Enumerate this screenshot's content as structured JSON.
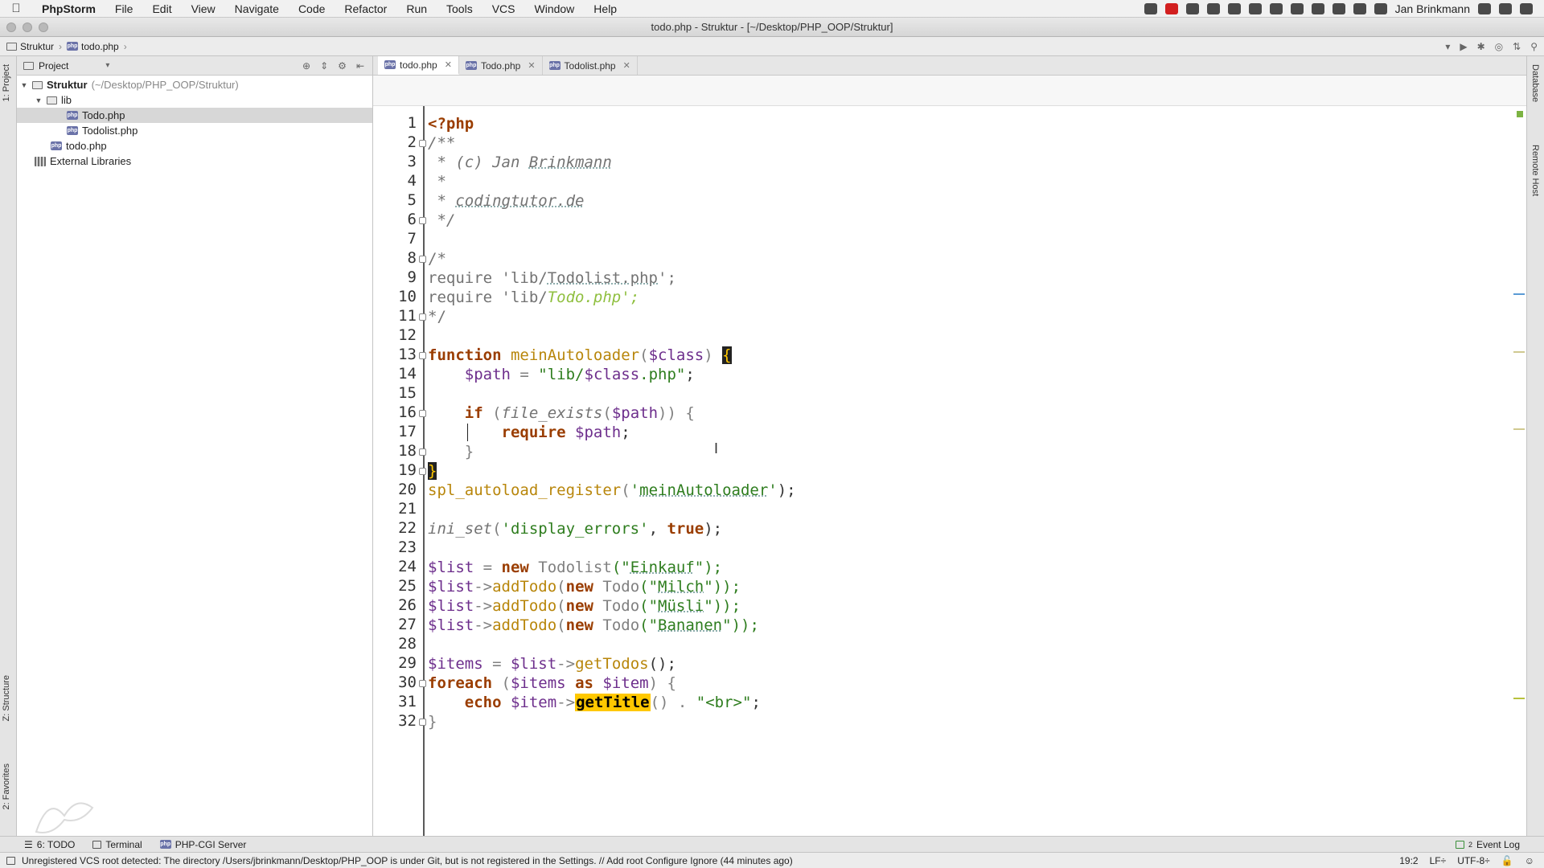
{
  "menubar": {
    "app": "PhpStorm",
    "items": [
      "File",
      "Edit",
      "View",
      "Navigate",
      "Code",
      "Refactor",
      "Run",
      "Tools",
      "VCS",
      "Window",
      "Help"
    ],
    "user": "Jan Brinkmann"
  },
  "window": {
    "title": "todo.php - Struktur - [~/Desktop/PHP_OOP/Struktur]"
  },
  "navbar": {
    "crumbs": [
      "Struktur",
      "todo.php"
    ]
  },
  "left_strip": {
    "project_tab": "1: Project",
    "structure_tab": "Z: Structure",
    "favorites_tab": "2: Favorites"
  },
  "project_panel": {
    "title": "Project",
    "tree": [
      {
        "label": "Struktur",
        "path": "(~/Desktop/PHP_OOP/Struktur)",
        "icon": "folder-icon",
        "expanded": true
      },
      {
        "label": "lib",
        "icon": "folder-icon",
        "expanded": true
      },
      {
        "label": "Todo.php",
        "icon": "php-file-icon",
        "selected": true
      },
      {
        "label": "Todolist.php",
        "icon": "php-file-icon"
      },
      {
        "label": "todo.php",
        "icon": "php-file-icon"
      },
      {
        "label": "External Libraries",
        "icon": "library-icon"
      }
    ]
  },
  "editor": {
    "tabs": [
      {
        "label": "todo.php",
        "active": true
      },
      {
        "label": "Todo.php",
        "active": false
      },
      {
        "label": "Todolist.php",
        "active": false
      }
    ],
    "line_numbers": [
      "1",
      "2",
      "3",
      "4",
      "5",
      "6",
      "7",
      "8",
      "9",
      "10",
      "11",
      "12",
      "13",
      "14",
      "15",
      "16",
      "17",
      "18",
      "19",
      "20",
      "21",
      "22",
      "23",
      "24",
      "25",
      "26",
      "27",
      "28",
      "29",
      "30",
      "31",
      "32"
    ],
    "code": {
      "l1": "<?php",
      "l2": "/**",
      "l3a": " * (c) Jan ",
      "l3b": "Brinkmann",
      "l4": " *",
      "l5a": " * ",
      "l5b": "codingtutor.de",
      "l6": " */",
      "l8": "/*",
      "l9a": "require 'lib/",
      "l9b": "Todolist.php",
      "l9c": "';",
      "l10a": "require 'lib/",
      "l10b": "Todo.php';",
      "l11": "*/",
      "l13a": "function ",
      "l13b": "meinAutoloader",
      "l13c": "(",
      "l13d": "$class",
      "l13e": ") ",
      "l13f": "{",
      "l14a": "    ",
      "l14b": "$path",
      "l14c": " = ",
      "l14d": "\"lib/",
      "l14e": "$class",
      "l14f": ".php\"",
      "l14g": ";",
      "l16a": "    ",
      "l16b": "if",
      "l16c": " (",
      "l16d": "file_exists",
      "l16e": "(",
      "l16f": "$path",
      "l16g": ")) {",
      "l17a": "        ",
      "l17b": "require",
      "l17c": " ",
      "l17d": "$path",
      "l17e": ";",
      "l18": "    }",
      "l19": "}",
      "l20a": "spl_autoload_register",
      "l20b": "(",
      "l20c": "'",
      "l20d": "meinAutoloader",
      "l20e": "'",
      "l20f": ");",
      "l22a": "ini_set",
      "l22b": "(",
      "l22c": "'display_errors'",
      "l22d": ", ",
      "l22e": "true",
      "l22f": ");",
      "l24a": "$list",
      "l24b": " = ",
      "l24c": "new",
      "l24d": " Todolist",
      "l24e": "(\"",
      "l24f": "Einkauf",
      "l24g": "\");",
      "l25a": "$list",
      "l25b": "->",
      "l25c": "addTodo",
      "l25d": "(",
      "l25e": "new",
      "l25f": " Todo",
      "l25g": "(\"",
      "l25h": "Milch",
      "l25i": "\"));",
      "l26a": "$list",
      "l26b": "->",
      "l26c": "addTodo",
      "l26d": "(",
      "l26e": "new",
      "l26f": " Todo",
      "l26g": "(\"",
      "l26h": "Müsli",
      "l26i": "\"));",
      "l27a": "$list",
      "l27b": "->",
      "l27c": "addTodo",
      "l27d": "(",
      "l27e": "new",
      "l27f": " Todo",
      "l27g": "(\"",
      "l27h": "Bananen",
      "l27i": "\"));",
      "l29a": "$items",
      "l29b": " = ",
      "l29c": "$list",
      "l29d": "->",
      "l29e": "getTodos",
      "l29f": "();",
      "l30a": "foreach",
      "l30b": " (",
      "l30c": "$items",
      "l30d": " ",
      "l30e": "as",
      "l30f": " ",
      "l30g": "$item",
      "l30h": ") {",
      "l31a": "    ",
      "l31b": "echo",
      "l31c": " ",
      "l31d": "$item",
      "l31e": "->",
      "l31f": "getTitle",
      "l31g": "() . ",
      "l31h": "\"<br>\"",
      "l31i": ";",
      "l32": "}"
    }
  },
  "right_strip": {
    "database_tab": "Database",
    "remote_host_tab": "Remote Host"
  },
  "bottom_tools": {
    "todo": "6: TODO",
    "terminal": "Terminal",
    "phpcgi": "PHP-CGI Server",
    "event_log": "Event Log",
    "event_log_count": "2"
  },
  "status": {
    "message": "Unregistered VCS root detected: The directory /Users/jbrinkmann/Desktop/PHP_OOP is under Git, but is not registered in the Settings. // Add root  Configure  Ignore (44 minutes ago)",
    "position": "19:2",
    "line_sep": "LF÷",
    "encoding": "UTF-8÷"
  },
  "colors": {
    "keyword": "#9a3d00",
    "comment": "#737373",
    "string": "#2e7d1e",
    "function": "#b8860b",
    "variable": "#6d2e8c",
    "highlight": "#ffc800"
  }
}
